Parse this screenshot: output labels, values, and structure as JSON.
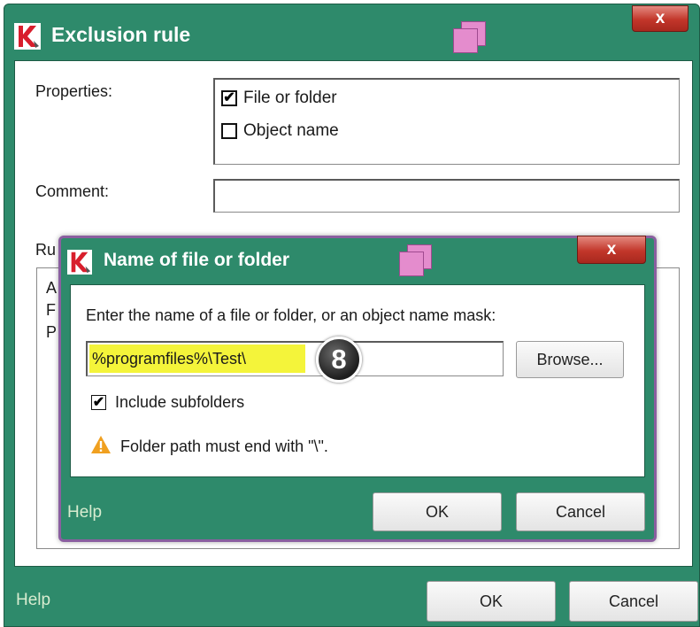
{
  "outer": {
    "title": "Exclusion rule",
    "close_glyph": "x",
    "properties_label": "Properties:",
    "properties_options": [
      {
        "label": "File or folder",
        "checked": true
      },
      {
        "label": "Object name",
        "checked": false
      }
    ],
    "comment_label": "Comment:",
    "comment_value": "",
    "rule_label_partial": "Ru",
    "rule_text_partial": [
      "A",
      "F",
      "P"
    ],
    "help_label": "Help",
    "ok_label": "OK",
    "cancel_label": "Cancel"
  },
  "inner": {
    "title": "Name of file or folder",
    "close_glyph": "x",
    "prompt": "Enter the name of a file or folder, or an object name mask:",
    "path_value": "%programfiles%\\Test\\",
    "step_badge": "8",
    "browse_label": "Browse...",
    "include_subfolders_label": "Include subfolders",
    "include_subfolders_checked": true,
    "warning_icon": "warning-triangle-icon",
    "warning_text": "Folder path must end with \"\\\".",
    "help_label": "Help",
    "ok_label": "OK",
    "cancel_label": "Cancel"
  },
  "colors": {
    "frame": "#2e8a6b",
    "highlight": "#f4f43a",
    "warning": "#f0a020",
    "stack_icon": "#e48ccd"
  }
}
